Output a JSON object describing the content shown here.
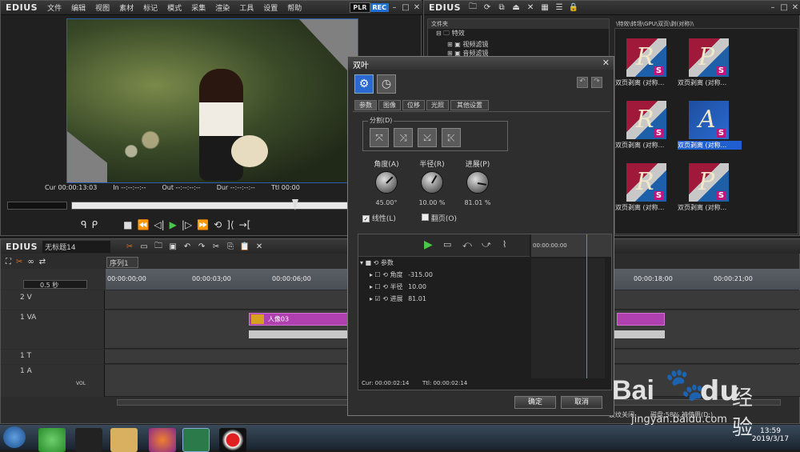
{
  "player": {
    "app": "EDIUS",
    "menu": [
      "文件",
      "编辑",
      "视图",
      "素材",
      "标记",
      "模式",
      "采集",
      "渲染",
      "工具",
      "设置",
      "帮助"
    ],
    "plr": "PLR",
    "rec": "REC",
    "timecodes": {
      "cur": "Cur 00:00:13:03",
      "in": "In --:--:--:--",
      "out": "Out --:--:--:--",
      "dur": "Dur --:--:--:--",
      "ttl": "Ttl 00:00"
    }
  },
  "bin": {
    "app": "EDIUS",
    "folder_header": "文件夹",
    "tree": [
      "特效",
      "视频滤镜",
      "音频滤镜"
    ],
    "path": "\\特效\\转场\\GPU\\双页\\剥(对称)\\",
    "items": [
      {
        "label": "双页剥离 (对称...",
        "letter": "R"
      },
      {
        "label": "双页剥离 (对称...",
        "letter": "P"
      },
      {
        "label": "双页剥离 (对称...",
        "letter": "R"
      },
      {
        "label": "双页剥离 (对称...",
        "letter": "A",
        "selected": true
      },
      {
        "label": "双页剥离 (对称...",
        "letter": "R"
      },
      {
        "label": "双页剥离 (对称...",
        "letter": "P"
      }
    ]
  },
  "timeline": {
    "app": "EDIUS",
    "project": "无标题14",
    "sequence_tab": "序列1",
    "zoom": "0.5 秒",
    "ruler": [
      "00:00:00;00",
      "00:00:03;00",
      "00:00:06;00",
      "00:00:18;00",
      "00:00:21;00"
    ],
    "tracks": [
      {
        "name": "2 V"
      },
      {
        "name": "1 VA"
      },
      {
        "name": "1 T"
      },
      {
        "name": "1 A"
      }
    ],
    "clip_label": "人像03",
    "vol": "VOL",
    "status": [
      "波纹关闭",
      "磁盘:58% 被使用(D:)"
    ]
  },
  "dialog": {
    "title": "双叶",
    "tabs": [
      "参数",
      "图像",
      "位移",
      "光照",
      "其他设置"
    ],
    "split_group": "分割(D)",
    "knobs": [
      {
        "label": "角度(A)",
        "value": "45.00°",
        "angle": -45
      },
      {
        "label": "半径(R)",
        "value": "10.00 %",
        "angle": -60
      },
      {
        "label": "进展(P)",
        "value": "81.01 %",
        "angle": 10
      }
    ],
    "linear": "线性(L)",
    "flip": "翻页(O)",
    "params_root": "参数",
    "params": [
      {
        "name": "角度",
        "value": "-315.00"
      },
      {
        "name": "半径",
        "value": "10.00"
      },
      {
        "name": "进展",
        "value": "81.01"
      }
    ],
    "kf_ruler": "00:00:00:00",
    "cur": "Cur: 00:00:02:14",
    "ttl": "Ttl: 00:00:02:14",
    "ok": "确定",
    "cancel": "取消"
  },
  "taskbar": {
    "time": "13:59",
    "date": "2019/3/17"
  },
  "watermark": {
    "brand": "Bai",
    "brand2": "du",
    "cn": "经验",
    "url": "jingyan.baidu.com"
  }
}
